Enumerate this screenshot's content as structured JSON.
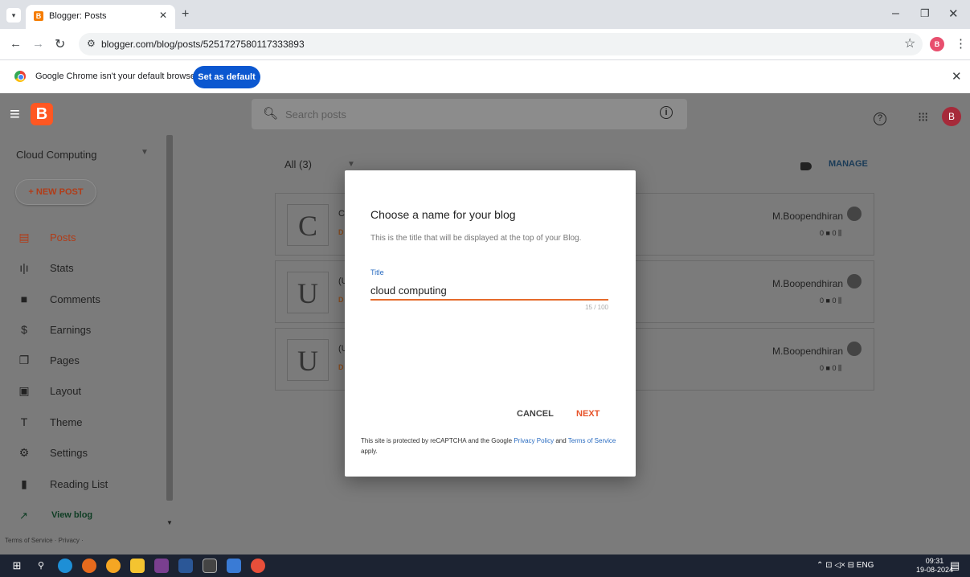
{
  "browser": {
    "tab_title": "Blogger: Posts",
    "tab_favicon": "B",
    "url": "blogger.com/blog/posts/5251727580117333893",
    "infobar_text": "Google Chrome isn't your default browser",
    "set_default_label": "Set as default",
    "profile_initial": "B"
  },
  "header": {
    "logo_letter": "B",
    "search_placeholder": "Search posts",
    "avatar_initial": "B"
  },
  "sidebar": {
    "blog_name": "Cloud Computing",
    "new_post_label": "+ NEW POST",
    "items": [
      {
        "label": "Posts",
        "icon": "posts-icon"
      },
      {
        "label": "Stats",
        "icon": "stats-icon"
      },
      {
        "label": "Comments",
        "icon": "comments-icon"
      },
      {
        "label": "Earnings",
        "icon": "earnings-icon"
      },
      {
        "label": "Pages",
        "icon": "pages-icon"
      },
      {
        "label": "Layout",
        "icon": "layout-icon"
      },
      {
        "label": "Theme",
        "icon": "theme-icon"
      },
      {
        "label": "Settings",
        "icon": "settings-icon"
      },
      {
        "label": "Reading List",
        "icon": "bookmark-icon"
      }
    ],
    "view_blog_label": "View blog",
    "terms_text": "Terms of Service · Privacy ·"
  },
  "posts": {
    "filter_label": "All (3)",
    "manage_label": "MANAGE",
    "items": [
      {
        "letter": "C",
        "title_frag": "C",
        "status_frag": "D",
        "author": "M.Boopendhiran",
        "stats": "0 ■  0 ⫼"
      },
      {
        "letter": "U",
        "title_frag": "(U",
        "status_frag": "D",
        "author": "M.Boopendhiran",
        "stats": "0 ■  0 ⫼"
      },
      {
        "letter": "U",
        "title_frag": "(U",
        "status_frag": "D",
        "author": "M.Boopendhiran",
        "stats": "0 ■  0 ⫼"
      }
    ]
  },
  "dialog": {
    "title": "Choose a name for your blog",
    "subtitle": "This is the title that will be displayed at the top of your Blog.",
    "field_label": "Title",
    "field_value": "cloud computing",
    "char_count": "15 / 100",
    "cancel_label": "CANCEL",
    "next_label": "NEXT",
    "recaptcha_prefix": "This site is protected by reCAPTCHA and the Google ",
    "privacy_link": "Privacy Policy",
    "recaptcha_and": " and ",
    "terms_link": "Terms of Service",
    "recaptcha_suffix": " apply."
  },
  "taskbar": {
    "tray_text": "ENG",
    "time": "09:31",
    "date": "19-08-2024"
  },
  "colors": {
    "accent": "#e7542b",
    "link": "#2a6cc1",
    "chrome_button": "#0b57d0"
  }
}
